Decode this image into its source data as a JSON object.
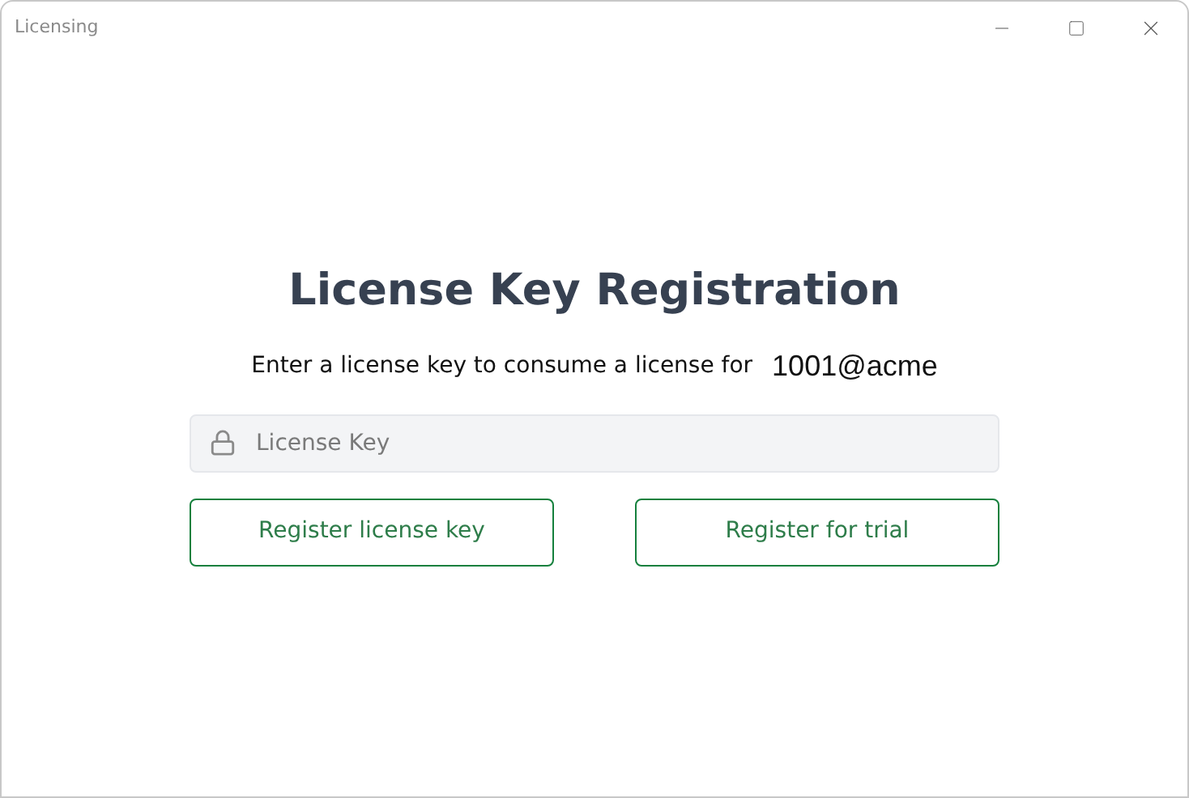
{
  "window": {
    "title": "Licensing"
  },
  "heading": "License Key Registration",
  "prompt": {
    "text": "Enter a license key to consume a license for",
    "server": "1001@acme"
  },
  "license_field": {
    "placeholder": "License Key"
  },
  "buttons": [
    "Register license key",
    "Register for trial"
  ]
}
